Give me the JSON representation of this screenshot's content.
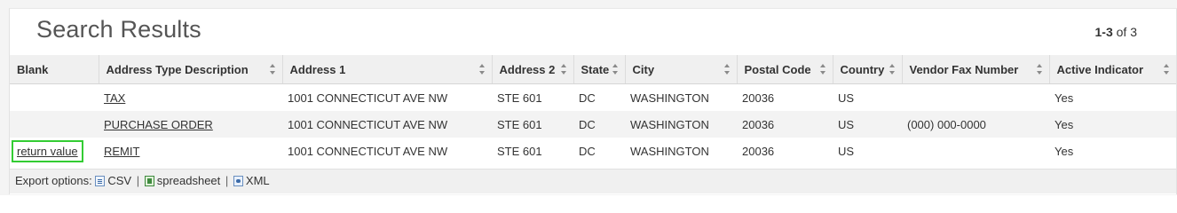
{
  "page": {
    "title": "Search Results",
    "count_range": "1-3",
    "count_total_text": "of 3"
  },
  "table": {
    "columns": [
      {
        "label": "Blank",
        "sortable": false
      },
      {
        "label": "Address Type Description",
        "sortable": true
      },
      {
        "label": "Address 1",
        "sortable": true
      },
      {
        "label": "Address 2",
        "sortable": true
      },
      {
        "label": "State",
        "sortable": true
      },
      {
        "label": "City",
        "sortable": true
      },
      {
        "label": "Postal Code",
        "sortable": true
      },
      {
        "label": "Country",
        "sortable": true
      },
      {
        "label": "Vendor Fax Number",
        "sortable": true
      },
      {
        "label": "Active Indicator",
        "sortable": true
      }
    ],
    "rows": [
      {
        "blank": "",
        "type": "TAX",
        "address1": "1001 CONNECTICUT AVE NW",
        "address2": "STE 601",
        "state": "DC",
        "city": "WASHINGTON",
        "postal": "20036",
        "country": "US",
        "fax": "",
        "active": "Yes"
      },
      {
        "blank": "",
        "type": "PURCHASE ORDER",
        "address1": "1001 CONNECTICUT AVE NW",
        "address2": "STE 601",
        "state": "DC",
        "city": "WASHINGTON",
        "postal": "20036",
        "country": "US",
        "fax": "(000) 000-0000",
        "active": "Yes"
      },
      {
        "blank": "return value",
        "type": "REMIT",
        "address1": "1001 CONNECTICUT AVE NW",
        "address2": "STE 601",
        "state": "DC",
        "city": "WASHINGTON",
        "postal": "20036",
        "country": "US",
        "fax": "",
        "active": "Yes"
      }
    ]
  },
  "export": {
    "label": "Export options:",
    "csv": "CSV",
    "spreadsheet": "spreadsheet",
    "xml": "XML",
    "separator": "|",
    "icons": [
      "csv-file-icon",
      "spreadsheet-file-icon",
      "xml-file-icon"
    ]
  },
  "colors": {
    "highlight": "#33cc33",
    "header_bg": "#f0f0f0",
    "stripe_bg": "#f3f3f3"
  }
}
